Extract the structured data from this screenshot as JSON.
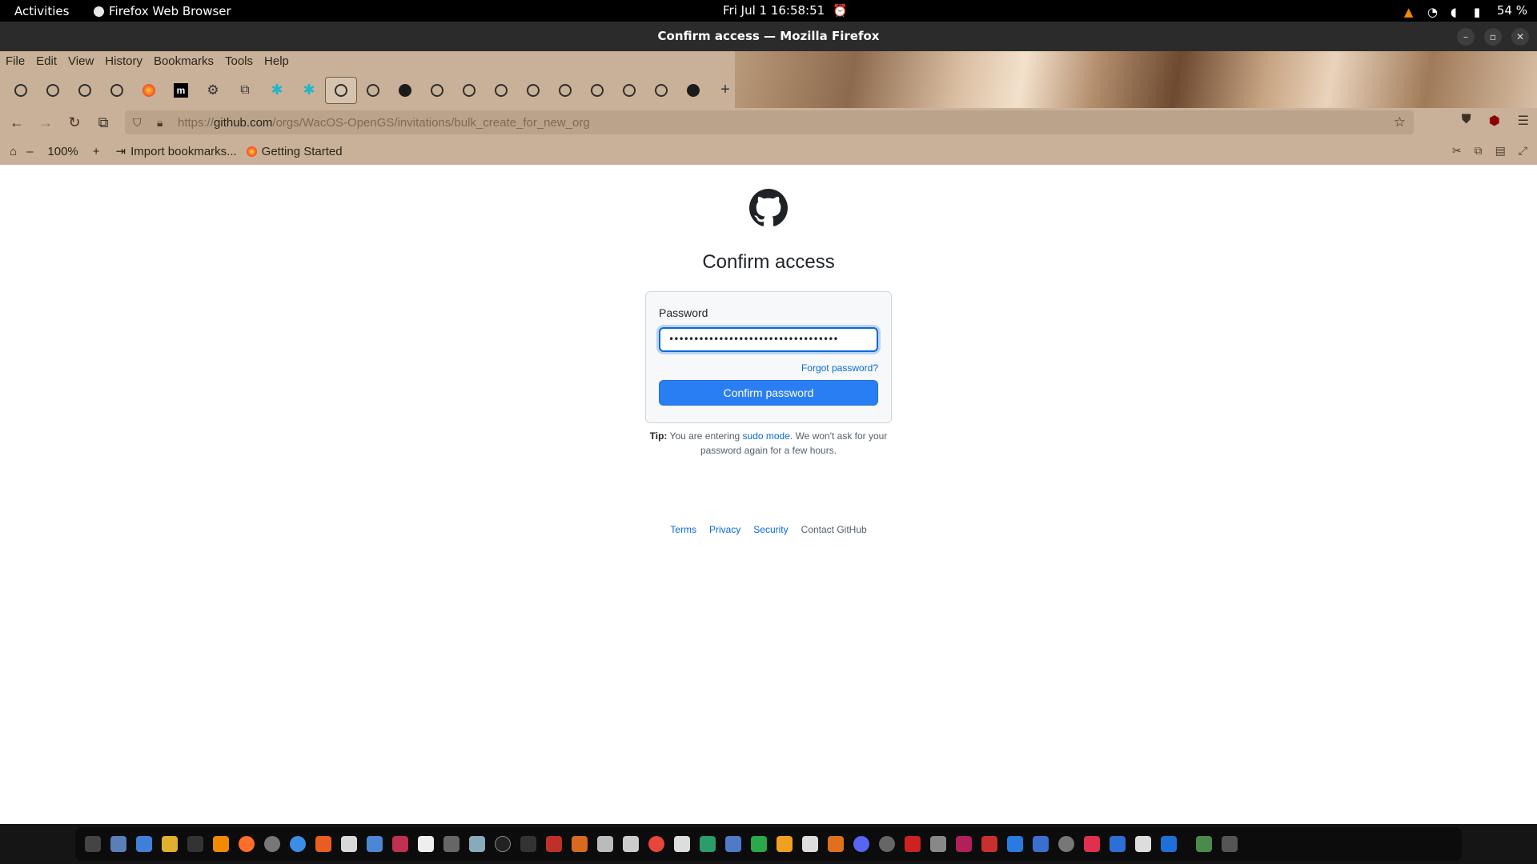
{
  "system": {
    "activities": "Activities",
    "app_name": "Firefox Web Browser",
    "datetime": "Fri Jul 1  16:58:51",
    "battery": "54 %"
  },
  "window": {
    "title": "Confirm access — Mozilla Firefox"
  },
  "menu": [
    "File",
    "Edit",
    "View",
    "History",
    "Bookmarks",
    "Tools",
    "Help"
  ],
  "urlbar": {
    "scheme": "https://",
    "host": "github.com",
    "path": "/orgs/WacOS-OpenGS/invitations/bulk_create_for_new_org"
  },
  "bookmarks_bar": {
    "zoom": "100%",
    "import": "Import bookmarks...",
    "getting_started": "Getting Started"
  },
  "page": {
    "heading": "Confirm access",
    "password_label": "Password",
    "password_value": "••••••••••••••••••••••••••••••••••",
    "forgot": "Forgot password?",
    "confirm_button": "Confirm password",
    "tip_label": "Tip:",
    "tip_pre": "You are entering",
    "tip_link": "sudo mode",
    "tip_post": ". We won't ask for your password again for a few hours.",
    "footer": {
      "terms": "Terms",
      "privacy": "Privacy",
      "security": "Security",
      "contact": "Contact GitHub"
    }
  },
  "colors": {
    "accent": "#2a7ef3",
    "link": "#0969da",
    "chrome": "#c9b199"
  }
}
